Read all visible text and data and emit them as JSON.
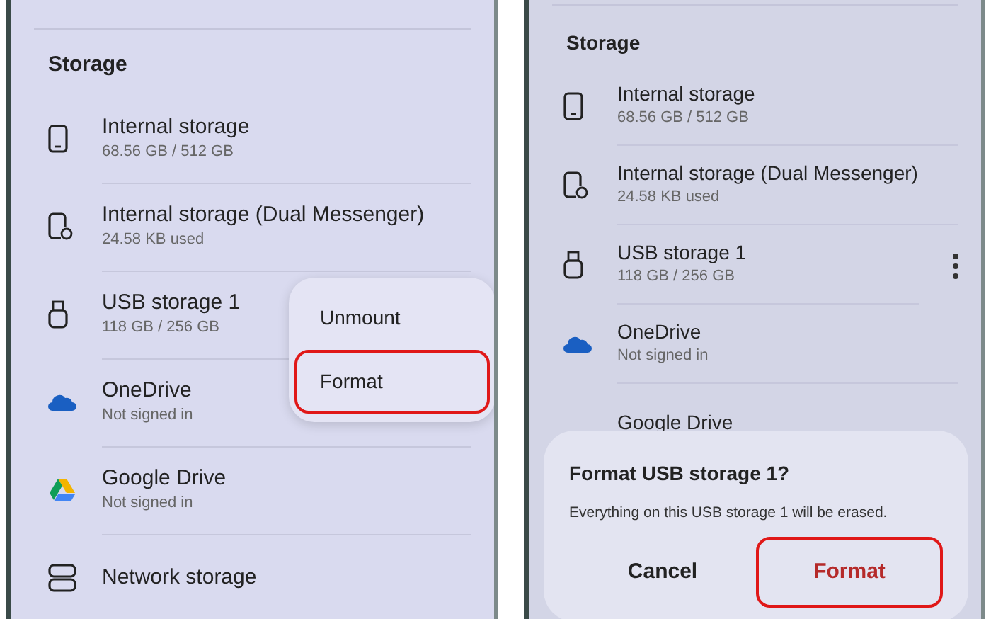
{
  "panels": [
    {
      "section_title": "Storage",
      "items": [
        {
          "kind": "phone",
          "title": "Internal storage",
          "subtitle": "68.56 GB / 512 GB",
          "more_button": false
        },
        {
          "kind": "dual",
          "title": "Internal storage (Dual Messenger)",
          "subtitle": "24.58 KB used",
          "more_button": false
        },
        {
          "kind": "usb",
          "title": "USB storage 1",
          "subtitle": "118 GB / 256 GB",
          "more_button": false
        },
        {
          "kind": "cloud",
          "title": "OneDrive",
          "subtitle": "Not signed in",
          "more_button": false
        },
        {
          "kind": "drive",
          "title": "Google Drive",
          "subtitle": "Not signed in",
          "more_button": false
        },
        {
          "kind": "network",
          "title": "Network storage",
          "more_button": false
        }
      ],
      "menu": {
        "items": [
          {
            "label": "Unmount",
            "highlighted": false
          },
          {
            "label": "Format",
            "highlighted": true
          }
        ]
      }
    },
    {
      "section_title": "Storage",
      "items": [
        {
          "kind": "phone",
          "title": "Internal storage",
          "subtitle": "68.56 GB / 512 GB",
          "more_button": false
        },
        {
          "kind": "dual",
          "title": "Internal storage (Dual Messenger)",
          "subtitle": "24.58 KB used",
          "more_button": false
        },
        {
          "kind": "usb",
          "title": "USB storage 1",
          "subtitle": "118 GB / 256 GB",
          "more_button": true
        },
        {
          "kind": "cloud",
          "title": "OneDrive",
          "subtitle": "Not signed in",
          "more_button": false
        },
        {
          "kind": "plain",
          "title": "Google Drive",
          "more_button": false
        }
      ],
      "dialog": {
        "title": "Format USB storage 1?",
        "message": "Everything on this USB storage 1 will be erased.",
        "buttons": [
          {
            "label": "Cancel",
            "highlighted": false,
            "kind": "cancel"
          },
          {
            "label": "Format",
            "highlighted": true,
            "kind": "confirm"
          }
        ]
      }
    }
  ]
}
